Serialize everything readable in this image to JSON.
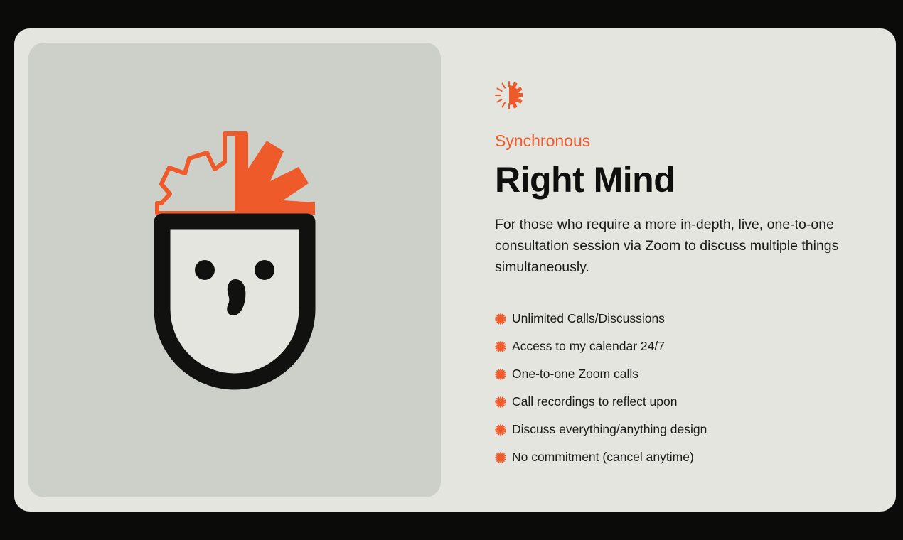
{
  "plan": {
    "category": "Synchronous",
    "title": "Right Mind",
    "description": "For those who require a more in-depth, live, one-to-one consultation session via Zoom to discuss multiple things simultaneously.",
    "features": [
      "Unlimited Calls/Discussions",
      "Access to my calendar 24/7",
      "One-to-one Zoom calls",
      "Call recordings to reflect upon",
      "Discuss everything/anything design",
      "No commitment (cancel anytime)"
    ]
  },
  "icons": {
    "brand": "half-sunburst-icon",
    "bullet": "asterisk-burst-icon",
    "illustration": "head-with-sunburst-illustration"
  },
  "colors": {
    "page_background": "#0b0b0a",
    "card_background": "#e4e5df",
    "panel_background": "#cdd0c8",
    "accent": "#ef5a2b",
    "ink": "#111110"
  }
}
